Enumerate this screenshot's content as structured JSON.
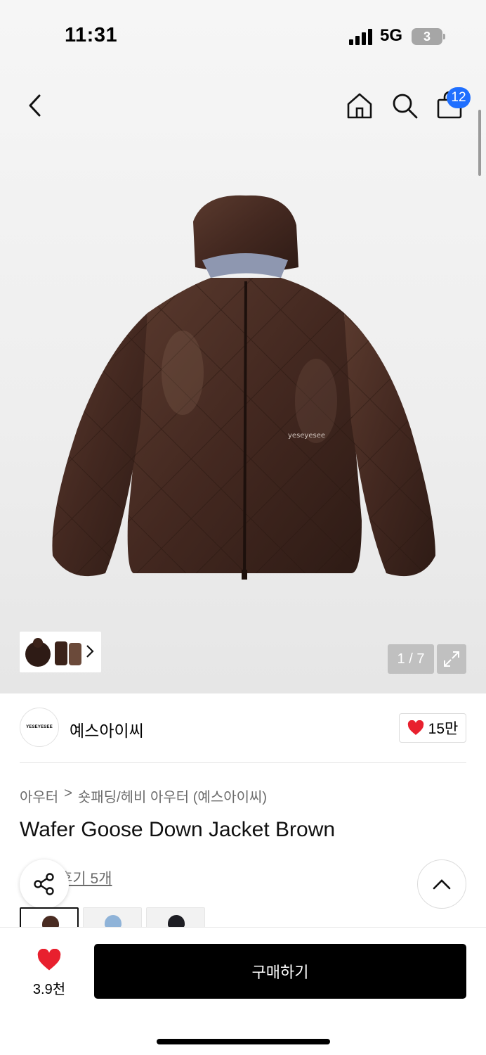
{
  "status_bar": {
    "time": "11:31",
    "network": "5G",
    "battery": "3"
  },
  "nav": {
    "cart_count": "12"
  },
  "gallery": {
    "counter": "1 / 7"
  },
  "brand": {
    "logo_text": "YESEYESEE",
    "name": "예스아이씨",
    "likes": "15만"
  },
  "breadcrumb": {
    "category": "아우터",
    "separator": ">",
    "subcategory": "숏패딩/헤비 아우터 (예스아이씨)"
  },
  "product": {
    "title": "Wafer Goose Down Jacket Brown",
    "reviews": "후기 5개"
  },
  "bottom": {
    "wish_count": "3.9천",
    "buy_label": "구매하기"
  },
  "colors": {
    "accent": "#1f6fff",
    "heart": "#e8202e",
    "jacket": "#4a2c22"
  },
  "icons": [
    "back-icon",
    "home-icon",
    "search-icon",
    "bag-icon",
    "chevron-right-icon",
    "expand-icon",
    "heart-icon",
    "share-icon",
    "chevron-up-icon"
  ]
}
